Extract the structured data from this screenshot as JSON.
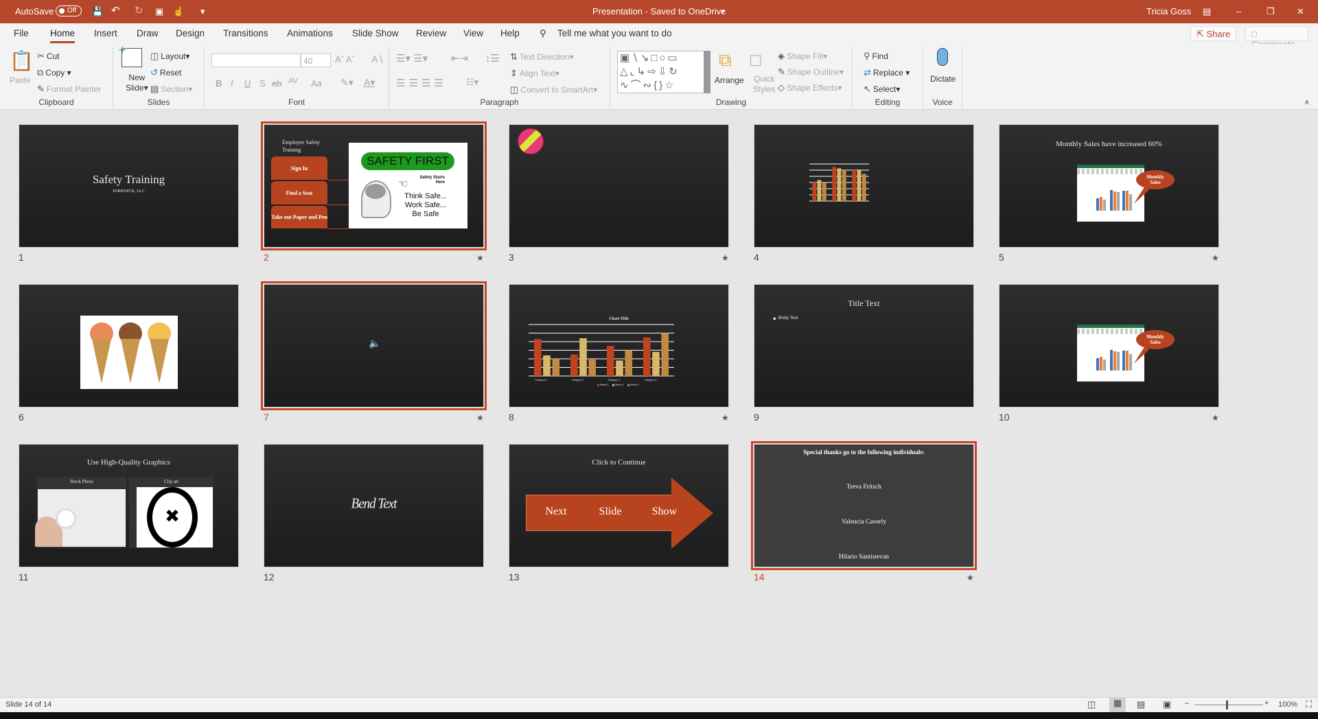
{
  "titlebar": {
    "autosave": "AutoSave",
    "autosave_state": "Off",
    "doc_title": "Presentation  -  Saved to OneDrive",
    "user": "Tricia Goss",
    "accent": "#B7472A"
  },
  "tabs": [
    "File",
    "Home",
    "Insert",
    "Draw",
    "Design",
    "Transitions",
    "Animations",
    "Slide Show",
    "Review",
    "View",
    "Help"
  ],
  "active_tab": "Home",
  "tell_me": "Tell me what you want to do",
  "share": "Share",
  "comments": "Comments",
  "ribbon": {
    "clipboard": {
      "label": "Clipboard",
      "paste": "Paste",
      "cut": "Cut",
      "copy": "Copy",
      "format_painter": "Format Painter"
    },
    "slides": {
      "label": "Slides",
      "new_slide": "New",
      "new_slide2": "Slide",
      "layout": "Layout",
      "reset": "Reset",
      "section": "Section"
    },
    "font": {
      "label": "Font",
      "font_name": "",
      "font_size": "40",
      "bold": "B",
      "italic": "I",
      "underline": "U",
      "shadow": "S",
      "strike": "ab",
      "spacing": "AV",
      "case": "Aa"
    },
    "paragraph": {
      "label": "Paragraph",
      "text_direction": "Text Direction",
      "align_text": "Align Text",
      "smartart": "Convert to SmartArt"
    },
    "drawing": {
      "label": "Drawing",
      "arrange": "Arrange",
      "quick_styles": "Quick",
      "quick_styles2": "Styles",
      "shape_fill": "Shape Fill",
      "shape_outline": "Shape Outline",
      "shape_effects": "Shape Effects"
    },
    "editing": {
      "label": "Editing",
      "find": "Find",
      "replace": "Replace",
      "select": "Select"
    },
    "voice": {
      "label": "Voice",
      "dictate": "Dictate"
    }
  },
  "slides": [
    {
      "num": "1",
      "title": "Safety Training",
      "subtitle": "PARKDECK, LLC"
    },
    {
      "num": "2",
      "title": "Employee Safety Training",
      "items": [
        "Sign In",
        "Find a Seat",
        "Take out Paper and Pen"
      ],
      "sign_banner": "SAFETY FIRST",
      "sign_side": "Safety Starts Here",
      "sign_lines": [
        "Think Safe...",
        "Work Safe...",
        "Be Safe"
      ],
      "selected": true,
      "star": true
    },
    {
      "num": "3",
      "star": true
    },
    {
      "num": "4",
      "chart": {
        "type": "bar",
        "ylim": [
          0,
          3000
        ],
        "series": [
          [
            1500,
            1700,
            1450
          ],
          [
            2750,
            2650,
            2500
          ],
          [
            2500,
            2550,
            2200
          ]
        ]
      }
    },
    {
      "num": "5",
      "title": "Monthly Sales have increased 60%",
      "callout": "Monthly Sales",
      "star": true
    },
    {
      "num": "6"
    },
    {
      "num": "7",
      "selected": true,
      "star": true
    },
    {
      "num": "8",
      "chart": {
        "type": "bar",
        "title": "Chart Title",
        "ylim": [
          0,
          6
        ],
        "categories": [
          "Category 1",
          "Category 2",
          "Category 3",
          "Category 4"
        ],
        "series": [
          {
            "name": "Series 1",
            "values": [
              4.3,
              2.5,
              3.5,
              4.5
            ]
          },
          {
            "name": "Series 2",
            "values": [
              2.4,
              4.4,
              1.8,
              2.8
            ]
          },
          {
            "name": "Series 3",
            "values": [
              2,
              2,
              3,
              5
            ]
          }
        ]
      },
      "star": true
    },
    {
      "num": "9",
      "title": "Title Text",
      "body": "Body Text"
    },
    {
      "num": "10",
      "callout": "Monthly Sales",
      "star": true
    },
    {
      "num": "11",
      "title": "Use High-Quality Graphics",
      "left_label": "Stock Photo",
      "right_label": "Clip art"
    },
    {
      "num": "12",
      "wordart": "Bend Text"
    },
    {
      "num": "13",
      "title": "Click to Continue",
      "arrow_words": [
        "Next",
        "Slide",
        "Show"
      ]
    },
    {
      "num": "14",
      "title": "Special thanks go to the following individuals:",
      "names": [
        "Treva Fritsch",
        "Valencia Caverly",
        "Hilario Santistevan"
      ],
      "selected": true,
      "star": true
    }
  ],
  "series_colors": [
    "#C0431F",
    "#D9B86A",
    "#C08A45"
  ],
  "status": {
    "slide_count": "Slide 14 of 14",
    "zoom": "100%"
  }
}
